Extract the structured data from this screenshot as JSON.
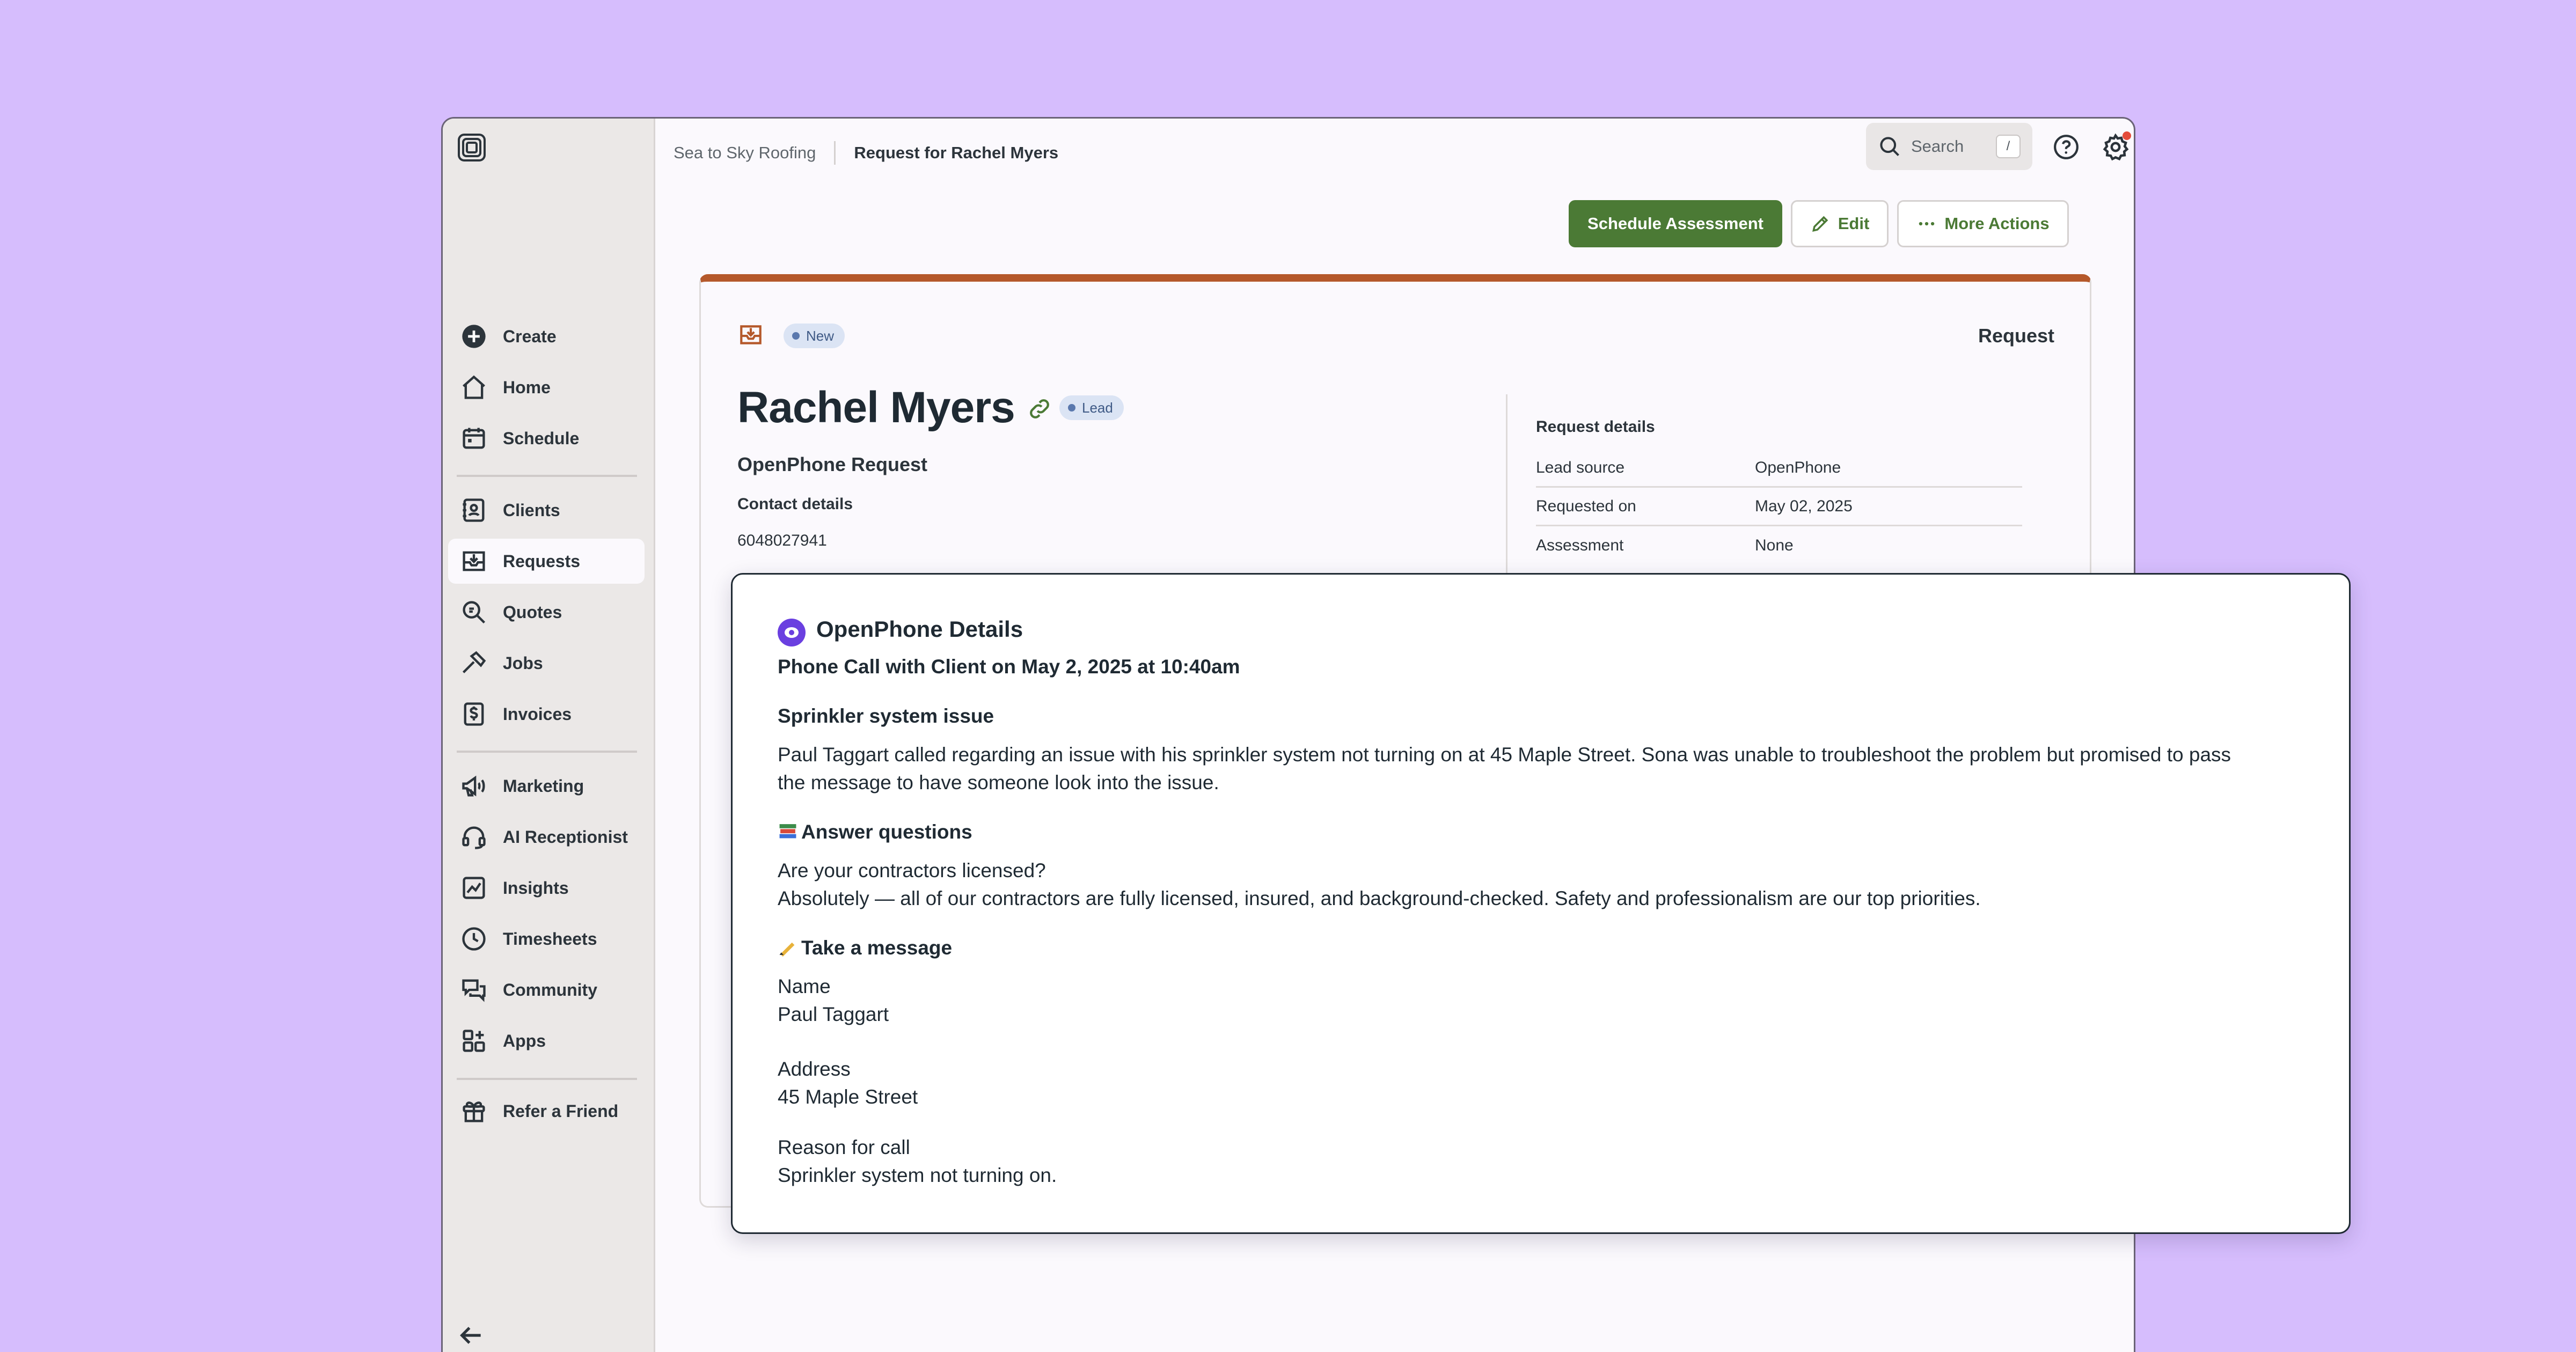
{
  "sidebar": {
    "items": [
      {
        "label": "Create",
        "icon": "plus-circle-icon"
      },
      {
        "label": "Home",
        "icon": "home-icon"
      },
      {
        "label": "Schedule",
        "icon": "calendar-icon"
      },
      {
        "label": "Clients",
        "icon": "address-book-icon"
      },
      {
        "label": "Requests",
        "icon": "inbox-download-icon",
        "active": true
      },
      {
        "label": "Quotes",
        "icon": "quote-search-icon"
      },
      {
        "label": "Jobs",
        "icon": "hammer-icon"
      },
      {
        "label": "Invoices",
        "icon": "invoice-dollar-icon"
      },
      {
        "label": "Marketing",
        "icon": "megaphone-icon"
      },
      {
        "label": "AI Receptionist",
        "icon": "headset-icon"
      },
      {
        "label": "Insights",
        "icon": "chart-icon"
      },
      {
        "label": "Timesheets",
        "icon": "clock-icon"
      },
      {
        "label": "Community",
        "icon": "chat-bubbles-icon"
      },
      {
        "label": "Apps",
        "icon": "apps-grid-icon"
      },
      {
        "label": "Refer a Friend",
        "icon": "gift-icon"
      }
    ]
  },
  "header": {
    "breadcrumb_company": "Sea to Sky Roofing",
    "breadcrumb_page": "Request for Rachel Myers",
    "search_placeholder": "Search",
    "search_shortcut": "/"
  },
  "actions": {
    "primary": "Schedule Assessment",
    "edit": "Edit",
    "more": "More Actions"
  },
  "request": {
    "status": "New",
    "card_type": "Request",
    "client_name": "Rachel Myers",
    "client_tag": "Lead",
    "title": "OpenPhone Request",
    "contact_heading": "Contact details",
    "phone": "6048027941",
    "details_heading": "Request details",
    "details": [
      {
        "key": "Lead source",
        "value": "OpenPhone"
      },
      {
        "key": "Requested on",
        "value": "May 02, 2025"
      },
      {
        "key": "Assessment",
        "value": "None"
      }
    ]
  },
  "openphone": {
    "title": "OpenPhone Details",
    "call_summary": "Phone Call with Client on May 2, 2025 at 10:40am",
    "issue_heading": "Sprinkler system issue",
    "issue_line1": "Paul Taggart called regarding an issue with his sprinkler system not turning on at 45 Maple Street. Sona was unable to troubleshoot the problem but promised to pass",
    "issue_line2": "the message to have someone look into the issue.",
    "questions_heading": "Answer questions",
    "question": "Are your contractors licensed?",
    "answer": "Absolutely — all of our contractors are fully licensed, insured, and background-checked. Safety and professionalism are our top priorities.",
    "message_heading": "Take a message",
    "name_label": "Name",
    "name_value": "Paul Taggart",
    "address_label": "Address",
    "address_value": "45 Maple Street",
    "reason_label": "Reason for call",
    "reason_value": "Sprinkler system not turning on."
  },
  "colors": {
    "background": "#d6bdfd",
    "primary_green": "#4b7a35",
    "request_accent": "#b5592b",
    "openphone_purple": "#6a3fe0"
  }
}
